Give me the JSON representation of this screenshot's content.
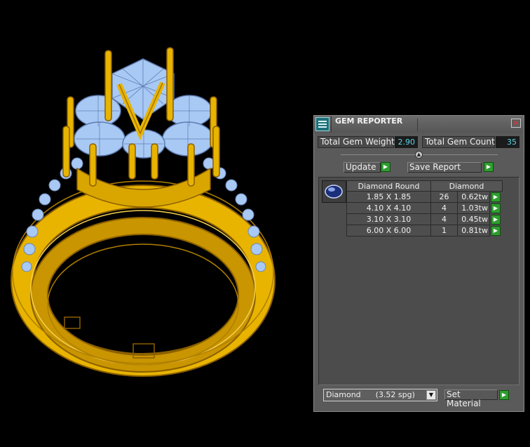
{
  "panel": {
    "title": "GEM REPORTER",
    "close_glyph": "✕",
    "icon": "gem-reporter-app-icon"
  },
  "totals": {
    "weight_label": "Total Gem Weight",
    "weight_value": "2.90",
    "count_label": "Total Gem Count",
    "count_value": "35"
  },
  "actions": {
    "update_label": "Update",
    "save_report_label": "Save Report",
    "go_glyph": "▶",
    "slider_glyph": "▲"
  },
  "table": {
    "headers": [
      "Diamond Round",
      "Diamond"
    ],
    "rows": [
      {
        "size": "1.85 X 1.85",
        "count": "26",
        "weight": "0.62tw"
      },
      {
        "size": "4.10 X 4.10",
        "count": "4",
        "weight": "1.03tw"
      },
      {
        "size": "3.10 X 3.10",
        "count": "4",
        "weight": "0.45tw"
      },
      {
        "size": "6.00 X 6.00",
        "count": "1",
        "weight": "0.81tw"
      }
    ]
  },
  "material": {
    "selected": "Diamond      (3.52 spg)",
    "set_label": "Set Material",
    "arrow_glyph": "▼"
  },
  "colors": {
    "metal": "#e8b400",
    "metal_wire": "#8a5f00",
    "gem": "#a9c9f5",
    "value_text": "#5ad6e6",
    "go_button": "#2f9d2f",
    "background": "#000000"
  }
}
